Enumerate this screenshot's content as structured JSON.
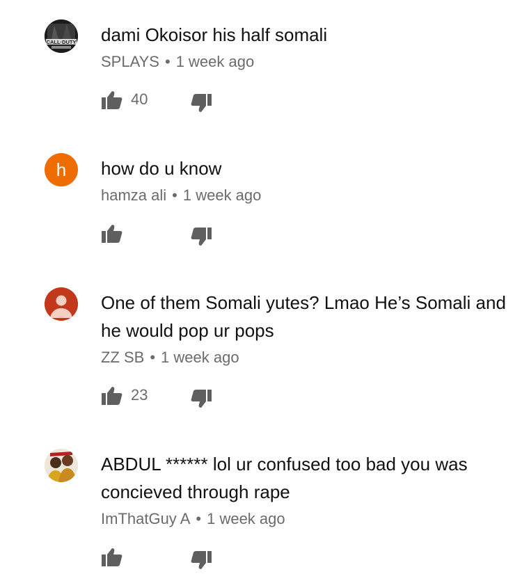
{
  "comments": [
    {
      "avatar_icon": "call-of-duty-game-avatar",
      "avatar_text": "CALL·DUTY",
      "text": "dami Okoisor his half somali",
      "author": "SPLAYS",
      "time": "1 week ago",
      "likes": "40"
    },
    {
      "avatar_icon": "letter-avatar",
      "avatar_letter": "h",
      "avatar_color": "#ef6c00",
      "text": "how do u know",
      "author": "hamza ali",
      "time": "1 week ago",
      "likes": ""
    },
    {
      "avatar_icon": "default-user-avatar",
      "avatar_color": "#c2381a",
      "text": "One of them Somali yutes? Lmao He’s Somali and he would pop ur pops",
      "author": "ZZ SB",
      "time": "1 week ago",
      "likes": "23"
    },
    {
      "avatar_icon": "photo-avatar",
      "text": "ABDUL ****** lol ur confused too bad you was concieved through rape",
      "author": "ImThatGuy A",
      "time": "1 week ago",
      "likes": ""
    }
  ],
  "separator": "•",
  "colors": {
    "text": "#111111",
    "meta": "#6b6b6b",
    "icon": "#5f5f5f"
  }
}
